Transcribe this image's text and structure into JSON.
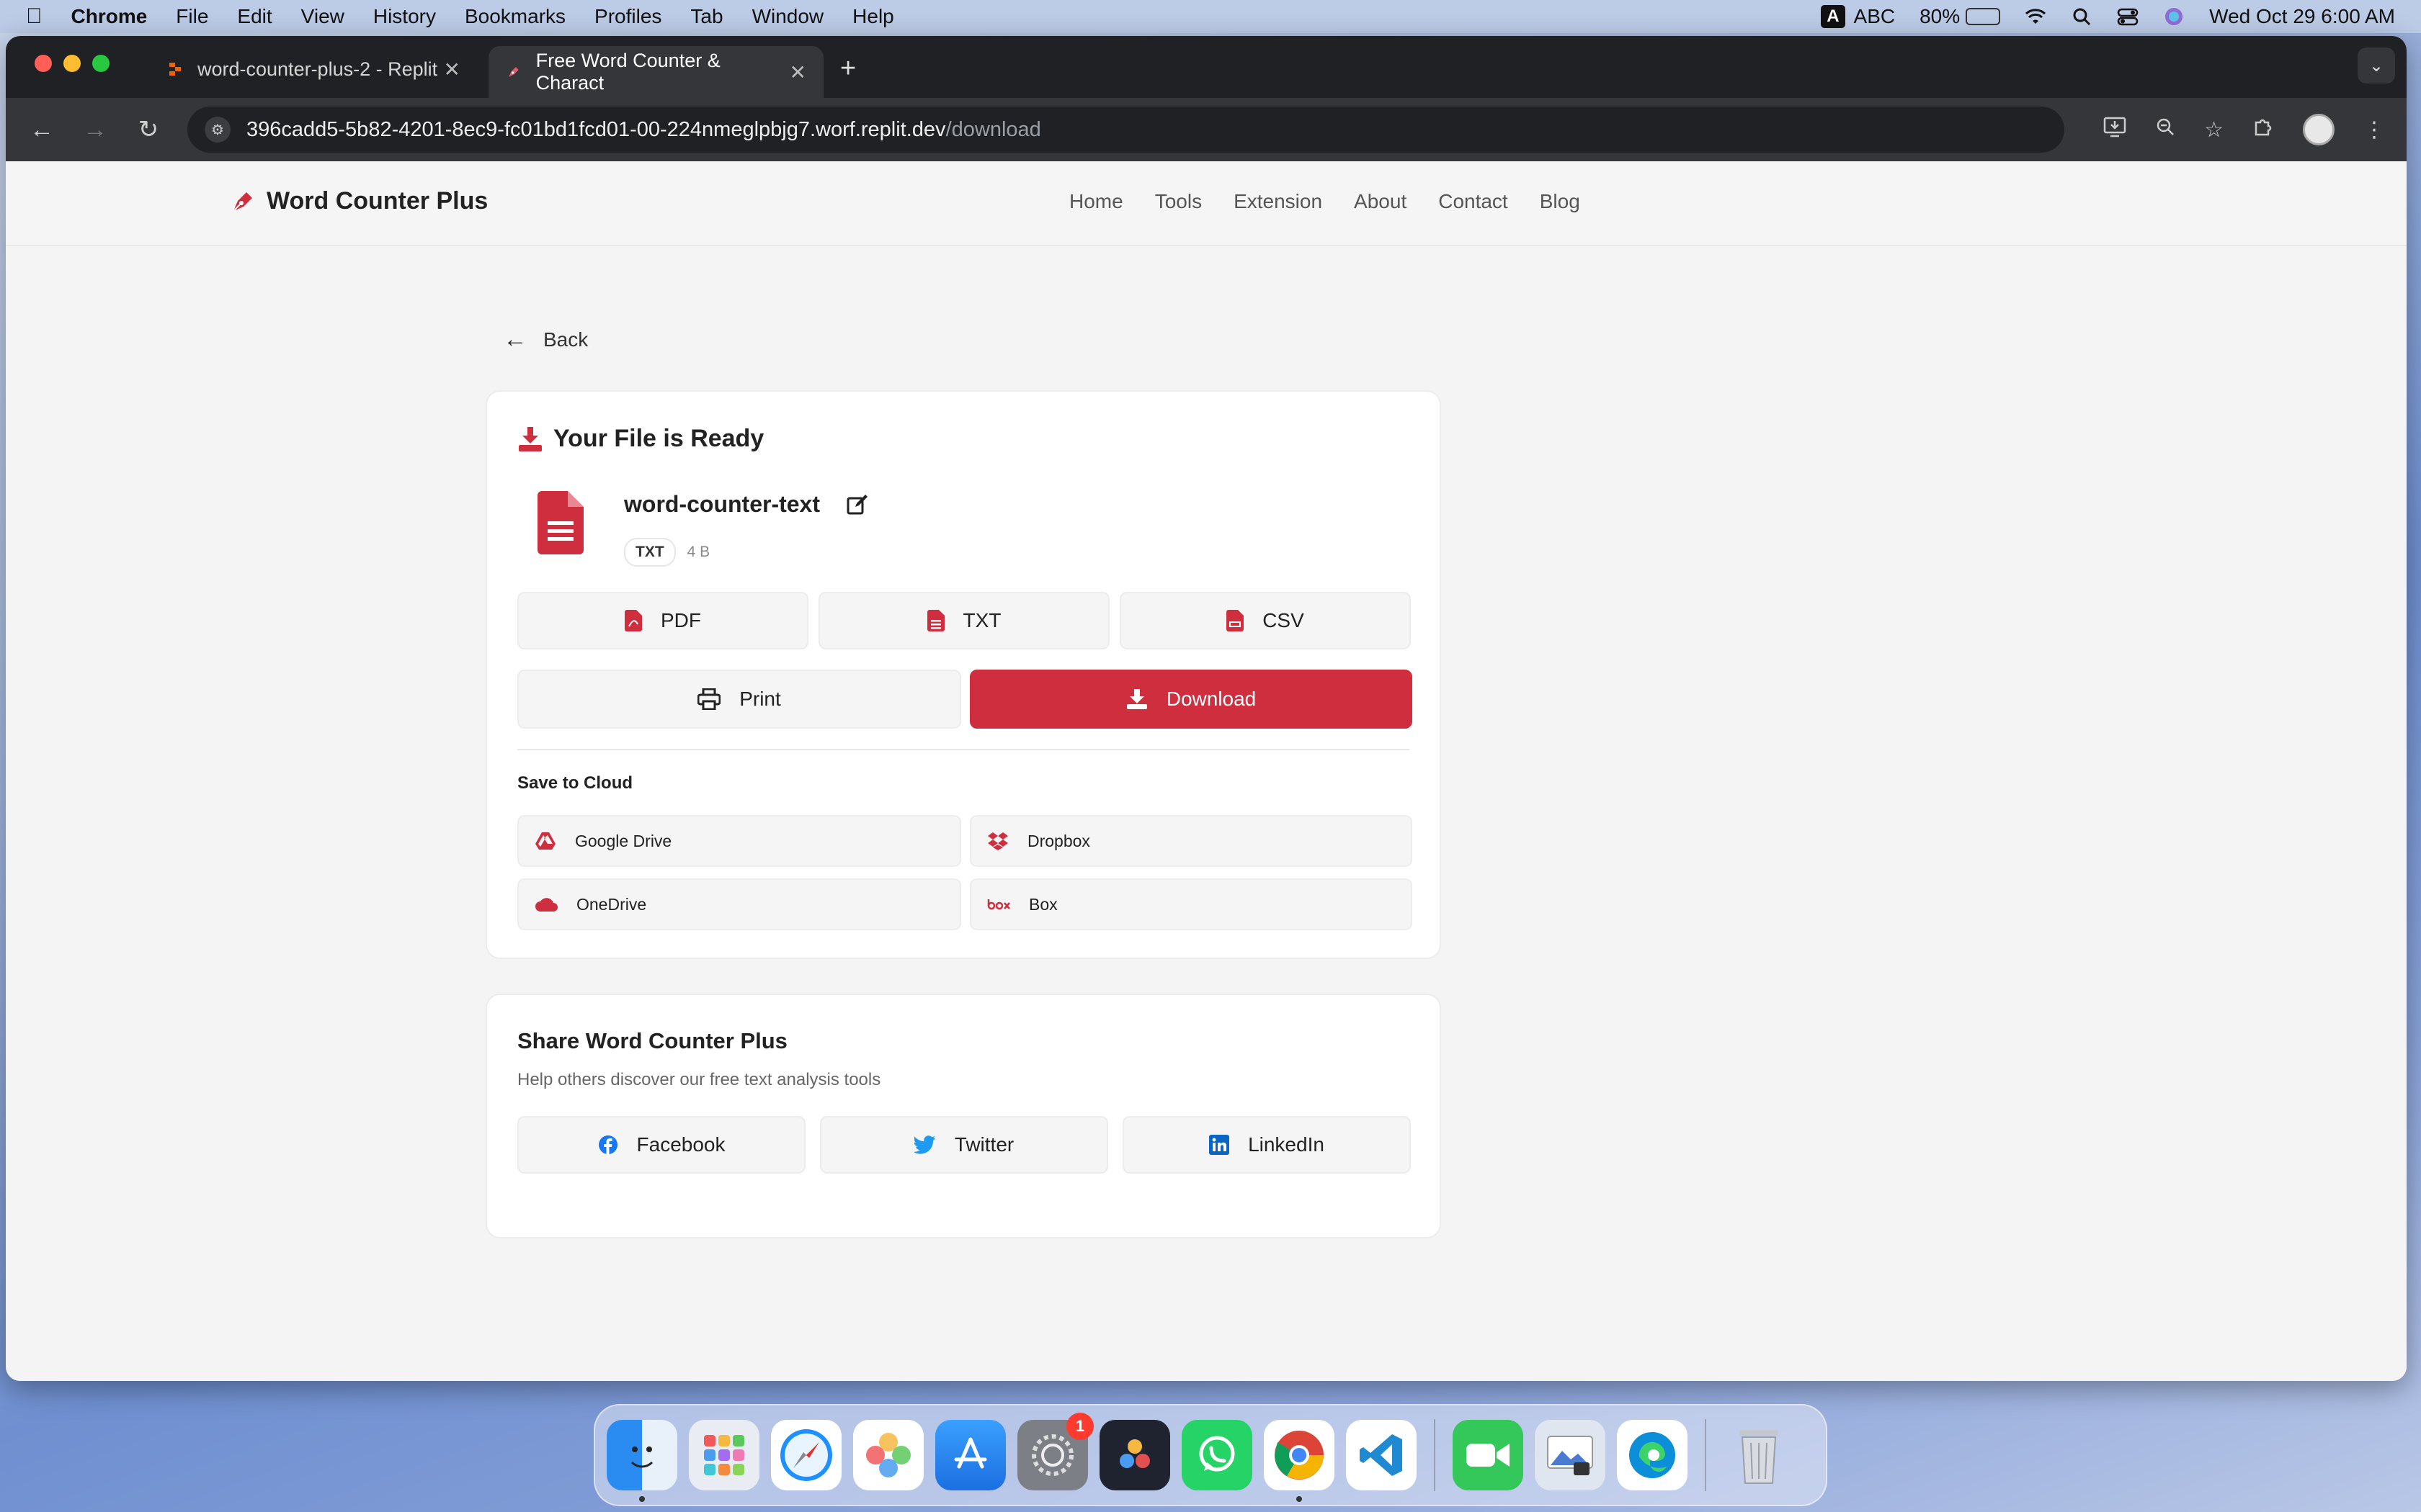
{
  "menubar": {
    "app_name": "Chrome",
    "items": [
      "File",
      "Edit",
      "View",
      "History",
      "Bookmarks",
      "Profiles",
      "Tab",
      "Window",
      "Help"
    ],
    "input_badge": "A",
    "input_source": "ABC",
    "battery_percent": "80%",
    "battery_level": 0.8,
    "datetime": "Wed Oct 29  6:00 AM"
  },
  "browser": {
    "tabs": [
      {
        "title": "word-counter-plus-2 - Replit",
        "active": false
      },
      {
        "title": "Free Word Counter & Charact",
        "active": true
      }
    ],
    "url_host": "396cadd5-5b82-4201-8ec9-fc01bd1fcd01-00-224nmeglpbjg7.worf.replit.dev",
    "url_path": "/download"
  },
  "site": {
    "brand": "Word Counter Plus",
    "nav": [
      "Home",
      "Tools",
      "Extension",
      "About",
      "Contact",
      "Blog"
    ],
    "accent_color": "#cf2e3f"
  },
  "download": {
    "back_label": "Back",
    "title": "Your File is Ready",
    "file_name": "word-counter-text",
    "file_type": "TXT",
    "file_size": "4 B",
    "formats": [
      "PDF",
      "TXT",
      "CSV"
    ],
    "print_label": "Print",
    "download_label": "Download",
    "cloud_heading": "Save to Cloud",
    "cloud": [
      "Google Drive",
      "Dropbox",
      "OneDrive",
      "Box"
    ]
  },
  "share": {
    "title": "Share Word Counter Plus",
    "subtitle": "Help others discover our free text analysis tools",
    "buttons": [
      "Facebook",
      "Twitter",
      "LinkedIn"
    ]
  },
  "dock": {
    "apps": [
      "Finder",
      "Launchpad",
      "Safari",
      "Photos",
      "App Store",
      "System Settings",
      "DaVinci Resolve",
      "WhatsApp",
      "Google Chrome",
      "Visual Studio Code",
      "FaceTime",
      "Preview",
      "Microsoft Edge",
      "Trash"
    ],
    "settings_badge": "1"
  }
}
